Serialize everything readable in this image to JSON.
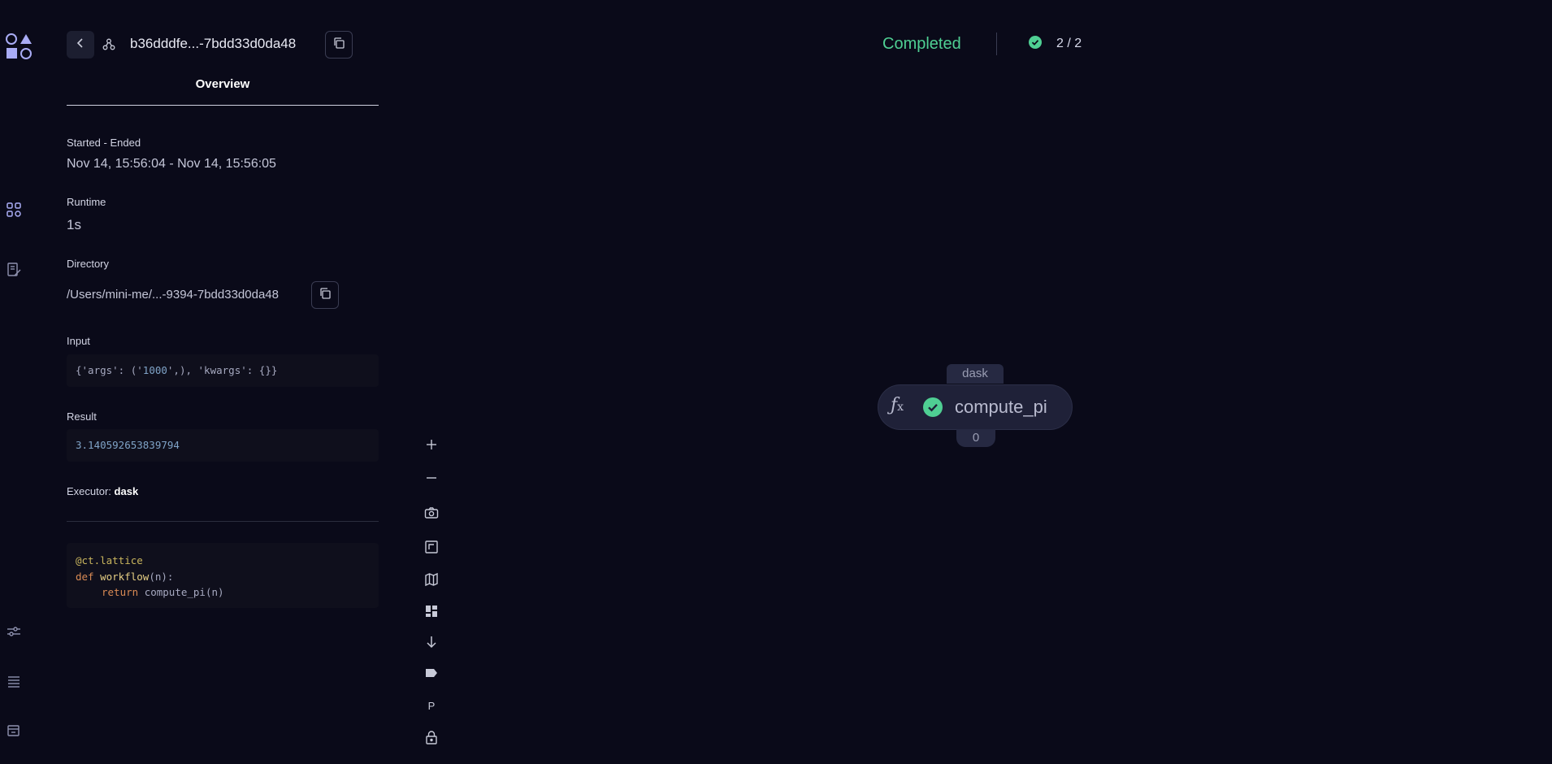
{
  "header": {
    "title": "b36dddfe...-7bdd33d0da48",
    "tab": "Overview"
  },
  "overview": {
    "started_label": "Started - Ended",
    "started_value": "Nov 14, 15:56:04 - Nov 14, 15:56:05",
    "runtime_label": "Runtime",
    "runtime_value": "1s",
    "directory_label": "Directory",
    "directory_value": "/Users/mini-me/...-9394-7bdd33d0da48",
    "input_label": "Input",
    "input_pre": "{'args': ('",
    "input_num": "1000",
    "input_post": "',), 'kwargs': {}}",
    "result_label": "Result",
    "result_value": "3.140592653839794",
    "executor_label": "Executor:",
    "executor_value": "dask"
  },
  "code": {
    "line1": "@ct.lattice",
    "line2_kw": "def",
    "line2_fn": "workflow",
    "line2_rest": "(n):",
    "line3_kw": "return",
    "line3_rest": "compute_pi(n)"
  },
  "status": {
    "text": "Completed",
    "count": "2 / 2",
    "color": "#4fcf93"
  },
  "graph": {
    "executor_tag": "dask",
    "node_name": "compute_pi",
    "node_index": "0",
    "node_icon": "function-icon"
  },
  "toolbar": {
    "p_label": "P"
  },
  "icons": [
    "logo-icon",
    "back-icon",
    "lattice-icon",
    "copy-icon",
    "dashboard-icon",
    "logs-icon",
    "settings-icon",
    "queue-icon",
    "terminal-icon",
    "zoom-in-icon",
    "zoom-out-icon",
    "camera-icon",
    "fit-view-icon",
    "map-icon",
    "layout-icon",
    "arrow-down-icon",
    "label-icon",
    "lock-icon",
    "check-circle-icon"
  ]
}
